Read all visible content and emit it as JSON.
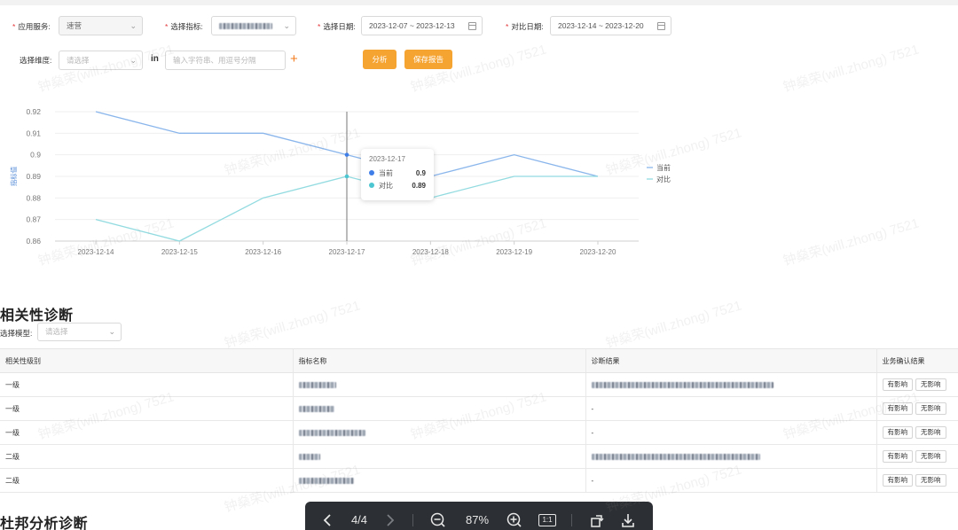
{
  "filters": {
    "service_label": "应用服务:",
    "service_value": "速营",
    "metric_label": "选择指标:",
    "date_label": "选择日期:",
    "date_value": "2023-12-07 ~ 2023-12-13",
    "compare_label": "对比日期:",
    "compare_value": "2023-12-14 ~ 2023-12-20",
    "dimension_label": "选择维度:",
    "dimension_placeholder": "请选择",
    "operator": "in",
    "value_placeholder": "输入字符串、用逗号分隔",
    "analyze_button": "分析",
    "save_button": "保存报告"
  },
  "chart_data": {
    "type": "line",
    "x": [
      "2023-12-14",
      "2023-12-15",
      "2023-12-16",
      "2023-12-17",
      "2023-12-18",
      "2023-12-19",
      "2023-12-20"
    ],
    "series": [
      {
        "name": "当前",
        "values": [
          0.92,
          0.91,
          0.91,
          0.9,
          0.89,
          0.9,
          0.89
        ],
        "color": "#8ab6ec"
      },
      {
        "name": "对比",
        "values": [
          0.87,
          0.86,
          0.88,
          0.89,
          0.88,
          0.89,
          0.89
        ],
        "color": "#92dbe0"
      }
    ],
    "ylabel": "指标值",
    "ylim": [
      0.86,
      0.92
    ],
    "yticks": [
      "0.92",
      "0.91",
      "0.9",
      "0.89",
      "0.88",
      "0.87",
      "0.86"
    ],
    "grid": true,
    "legend": "right",
    "tooltip": {
      "date": "2023-12-17",
      "rows": [
        {
          "name": "当前",
          "value": "0.9",
          "color": "#3f7ee8"
        },
        {
          "name": "对比",
          "value": "0.89",
          "color": "#4cc6d0"
        }
      ]
    }
  },
  "correlation": {
    "title": "相关性诊断",
    "model_label": "选择模型:",
    "model_placeholder": "请选择",
    "columns": [
      "相关性级别",
      "指标名称",
      "诊断结果",
      "业务确认结果"
    ],
    "rows": [
      {
        "level": "一级",
        "result": "",
        "confirm": [
          "有影响",
          "无影响"
        ]
      },
      {
        "level": "一级",
        "result": "-",
        "confirm": [
          "有影响",
          "无影响"
        ]
      },
      {
        "level": "一级",
        "result": "-",
        "confirm": [
          "有影响",
          "无影响"
        ]
      },
      {
        "level": "二级",
        "result": "",
        "confirm": [
          "有影响",
          "无影响"
        ]
      },
      {
        "level": "二级",
        "result": "-",
        "confirm": [
          "有影响",
          "无影响"
        ]
      }
    ]
  },
  "dupont": {
    "title": "杜邦分析诊断"
  },
  "viewer": {
    "page": "4/4",
    "zoom": "87%",
    "actual_size": "1:1"
  },
  "watermark": {
    "text": "钟燊荣(will.zhong) 7521"
  }
}
